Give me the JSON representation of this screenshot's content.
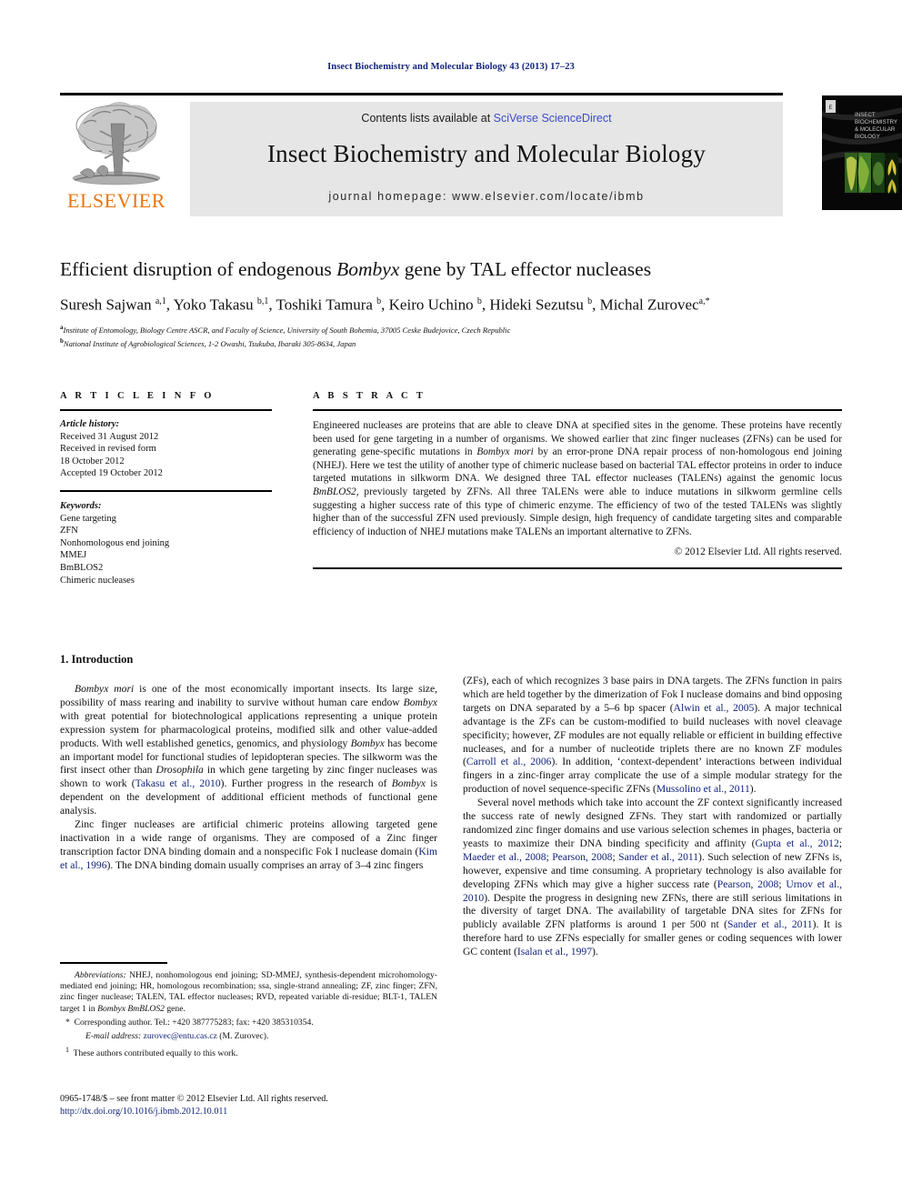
{
  "running_head": "Insect Biochemistry and Molecular Biology 43 (2013) 17–23",
  "masthead": {
    "contents_prefix": "Contents lists available at ",
    "contents_link": "SciVerse ScienceDirect",
    "journal_title": "Insect Biochemistry and Molecular Biology",
    "homepage": "journal homepage: www.elsevier.com/locate/ibmb",
    "publisher": "ELSEVIER",
    "publisher_color": "#e87511",
    "link_color": "#3b4ec4",
    "cover_caption": "INSECT BIOCHEMISTRY & MOLECULAR BIOLOGY"
  },
  "article": {
    "title_part1": "Efficient disruption of endogenous ",
    "title_italic": "Bombyx",
    "title_part2": " gene by TAL effector nucleases",
    "authors": "Suresh Sajwan a,1, Yoko Takasu b,1, Toshiki Tamura b, Keiro Uchino b, Hideki Sezutsu b, Michal Zurovec a,*",
    "affiliation_a": "Institute of Entomology, Biology Centre ASCR, and Faculty of Science, University of South Bohemia, 37005 Ceske Budejovice, Czech Republic",
    "affiliation_b": "National Institute of Agrobiological Sciences, 1-2 Owashi, Tsukuba, Ibaraki 305-8634, Japan"
  },
  "info": {
    "heading": "A R T I C L E   I N F O",
    "history_label": "Article history:",
    "history_lines": [
      "Received 31 August 2012",
      "Received in revised form",
      "18 October 2012",
      "Accepted 19 October 2012"
    ],
    "keywords_label": "Keywords:",
    "keywords": [
      "Gene targeting",
      "ZFN",
      "Nonhomologous end joining",
      "MMEJ",
      "BmBLOS2",
      "Chimeric nucleases"
    ]
  },
  "abstract": {
    "heading": "A B S T R A C T",
    "text_1": "Engineered nucleases are proteins that are able to cleave DNA at specified sites in the genome. These proteins have recently been used for gene targeting in a number of organisms. We showed earlier that zinc finger nucleases (ZFNs) can be used for generating gene-specific mutations in ",
    "italic_1": "Bombyx mori",
    "text_2": " by an error-prone DNA repair process of non-homologous end joining (NHEJ). Here we test the utility of another type of chimeric nuclease based on bacterial TAL effector proteins in order to induce targeted mutations in silkworm DNA. We designed three TAL effector nucleases (TALENs) against the genomic locus ",
    "italic_2": "BmBLOS2",
    "text_3": ", previously targeted by ZFNs. All three TALENs were able to induce mutations in silkworm germline cells suggesting a higher success rate of this type of chimeric enzyme. The efficiency of two of the tested TALENs was slightly higher than of the successful ZFN used previously. Simple design, high frequency of candidate targeting sites and comparable efficiency of induction of NHEJ mutations make TALENs an important alternative to ZFNs.",
    "copyright": "© 2012 Elsevier Ltd. All rights reserved."
  },
  "body": {
    "section_heading": "1. Introduction",
    "left_paragraphs": [
      {
        "runs": [
          {
            "t": "Bombyx mori",
            "s": "i"
          },
          {
            "t": " is one of the most economically important insects. Its large size, possibility of mass rearing and inability to survive without human care endow ",
            "s": ""
          },
          {
            "t": "Bombyx",
            "s": "i"
          },
          {
            "t": " with great potential for biotechnological applications representing a unique protein expression system for pharmacological proteins, modified silk and other value-added products. With well established genetics, genomics, and physiology ",
            "s": ""
          },
          {
            "t": "Bombyx",
            "s": "i"
          },
          {
            "t": " has become an important model for functional studies of lepidopteran species. The silkworm was the first insect other than ",
            "s": ""
          },
          {
            "t": "Drosophila",
            "s": "i"
          },
          {
            "t": " in which gene targeting by zinc finger nucleases was shown to work (",
            "s": ""
          },
          {
            "t": "Takasu et al., 2010",
            "s": "c"
          },
          {
            "t": "). Further progress in the research of ",
            "s": ""
          },
          {
            "t": "Bombyx",
            "s": "i"
          },
          {
            "t": " is dependent on the development of additional efficient methods of functional gene analysis.",
            "s": ""
          }
        ]
      },
      {
        "runs": [
          {
            "t": "Zinc finger nucleases are artificial chimeric proteins allowing targeted gene inactivation in a wide range of organisms. They are composed of a Zinc finger transcription factor DNA binding domain and a nonspecific Fok I nuclease domain (",
            "s": ""
          },
          {
            "t": "Kim et al., 1996",
            "s": "c"
          },
          {
            "t": "). The DNA binding domain usually comprises an array of 3–4 zinc fingers",
            "s": ""
          }
        ]
      }
    ],
    "right_paragraphs": [
      {
        "indent": false,
        "runs": [
          {
            "t": "(ZFs), each of which recognizes 3 base pairs in DNA targets. The ZFNs function in pairs which are held together by the dimerization of Fok I nuclease domains and bind opposing targets on DNA separated by a 5–6 bp spacer (",
            "s": ""
          },
          {
            "t": "Alwin et al., 2005",
            "s": "c"
          },
          {
            "t": "). A major technical advantage is the ZFs can be custom-modified to build nucleases with novel cleavage specificity; however, ZF modules are not equally reliable or efficient in building effective nucleases, and for a number of nucleotide triplets there are no known ZF modules (",
            "s": ""
          },
          {
            "t": "Carroll et al., 2006",
            "s": "c"
          },
          {
            "t": "). In addition, ‘context-dependent’ interactions between individual fingers in a zinc-finger array complicate the use of a simple modular strategy for the production of novel sequence-specific ZFNs (",
            "s": ""
          },
          {
            "t": "Mussolino et al., 2011",
            "s": "c"
          },
          {
            "t": ").",
            "s": ""
          }
        ]
      },
      {
        "indent": true,
        "runs": [
          {
            "t": "Several novel methods which take into account the ZF context significantly increased the success rate of newly designed ZFNs. They start with randomized or partially randomized zinc finger domains and use various selection schemes in phages, bacteria or yeasts to maximize their DNA binding specificity and affinity (",
            "s": ""
          },
          {
            "t": "Gupta et al., 2012",
            "s": "c"
          },
          {
            "t": "; ",
            "s": ""
          },
          {
            "t": "Maeder et al., 2008",
            "s": "c"
          },
          {
            "t": "; ",
            "s": ""
          },
          {
            "t": "Pearson, 2008",
            "s": "c"
          },
          {
            "t": "; ",
            "s": ""
          },
          {
            "t": "Sander et al., 2011",
            "s": "c"
          },
          {
            "t": "). Such selection of new ZFNs is, however, expensive and time consuming. A proprietary technology is also available for developing ZFNs which may give a higher success rate (",
            "s": ""
          },
          {
            "t": "Pearson, 2008",
            "s": "c"
          },
          {
            "t": "; ",
            "s": ""
          },
          {
            "t": "Urnov et al., 2010",
            "s": "c"
          },
          {
            "t": "). Despite the progress in designing new ZFNs, there are still serious limitations in the diversity of target DNA. The availability of targetable DNA sites for ZFNs for publicly available ZFN platforms is around 1 per 500 nt (",
            "s": ""
          },
          {
            "t": "Sander et al., 2011",
            "s": "c"
          },
          {
            "t": "). It is therefore hard to use ZFNs especially for smaller genes or coding sequences with lower GC content (",
            "s": ""
          },
          {
            "t": "Isalan et al., 1997",
            "s": "c"
          },
          {
            "t": ").",
            "s": ""
          }
        ]
      }
    ]
  },
  "footnotes": {
    "abbrev_label": "Abbreviations:",
    "abbrev_text": " NHEJ, nonhomologous end joining; SD-MMEJ, synthesis-dependent microhomology-mediated end joining; HR, homologous recombination; ssa, single-strand annealing; ZF, zinc finger; ZFN, zinc finger nuclease; TALEN, TAL effector nucleases; RVD, repeated variable di-residue; BLT-1, TALEN target 1 in ",
    "abbrev_italic_tail": "Bombyx BmBLOS2",
    "abbrev_tail_end": " gene.",
    "corresponding_marker": "*",
    "corresponding_text": "Corresponding author. Tel.: +420 387775283; fax: +420 385310354.",
    "email_label": "E-mail address:",
    "email": "zurovec@entu.cas.cz",
    "email_suffix": " (M. Zurovec).",
    "equal_marker": "1",
    "equal_text": "These authors contributed equally to this work."
  },
  "footer": {
    "issn_line": "0965-1748/$ – see front matter © 2012 Elsevier Ltd. All rights reserved.",
    "doi": "http://dx.doi.org/10.1016/j.ibmb.2012.10.011"
  }
}
